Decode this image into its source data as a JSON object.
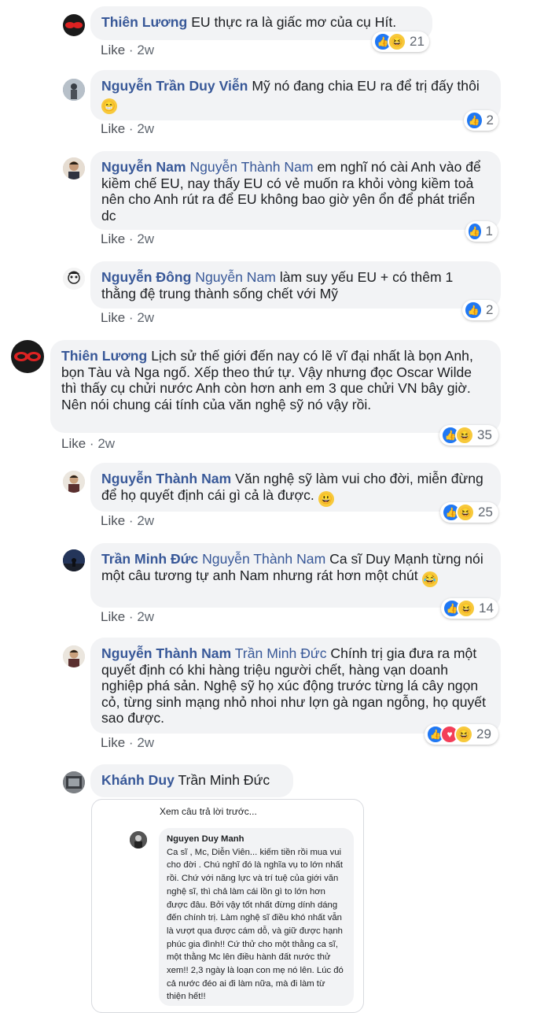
{
  "comments": [
    {
      "name": "Thiên Lương",
      "mention": "",
      "text": "EU thực ra là giấc mơ của cụ Hít.",
      "time": "2w",
      "reactions": "21"
    },
    {
      "name": "Nguyễn Trần Duy Viễn",
      "mention": "",
      "text": "Mỹ nó đang chia EU ra để trị đấy thôi",
      "time": "2w",
      "reactions": "2"
    },
    {
      "name": "Nguyễn Nam",
      "mention": "Nguyễn Thành Nam",
      "text": "em nghĩ nó cài Anh vào để kiềm chế EU, nay thấy EU có vẻ muốn ra khỏi vòng kiềm toả nên cho Anh rút ra để EU không bao giờ yên ổn để phát triển dc",
      "time": "2w",
      "reactions": "1"
    },
    {
      "name": "Nguyễn Đông",
      "mention": "Nguyễn Nam",
      "text": "làm suy yếu EU + có thêm 1 thằng đệ trung thành sống chết với Mỹ",
      "time": "2w",
      "reactions": "2"
    },
    {
      "name": "Thiên Lương",
      "mention": "",
      "text": "Lịch sử thế giới đến nay có lẽ vĩ đại nhất là bọn Anh, bọn Tàu và Nga ngố. Xếp theo thứ tự. Vậy nhưng đọc Oscar Wilde thì thấy cụ chửi nước Anh còn hơn anh em 3 que chửi VN bây giờ. Nên nói chung cái tính của văn nghệ sỹ nó vậy rồi.",
      "time": "2w",
      "reactions": "35"
    },
    {
      "name": "Nguyễn Thành Nam",
      "mention": "",
      "text": "Văn nghệ sỹ làm vui cho đời, miễn đừng để họ quyết định cái gì cả là được.",
      "time": "2w",
      "reactions": "25"
    },
    {
      "name": "Trần Minh Đức",
      "mention": "Nguyễn Thành Nam",
      "text": "Ca sĩ Duy Mạnh từng nói một câu tương tự anh Nam nhưng rát hơn một chút",
      "time": "2w",
      "reactions": "14"
    },
    {
      "name": "Nguyễn Thành Nam",
      "mention": "Trần Minh Đức",
      "text": "Chính trị gia đưa ra một quyết định có khi hàng triệu người chết, hàng vạn doanh nghiệp phá sản. Nghệ sỹ họ xúc động trước từng lá cây ngọn cỏ, từng sinh mạng nhỏ nhoi như lợn gà ngan ngỗng, họ quyết sao được.",
      "time": "2w",
      "reactions": "29"
    },
    {
      "name": "Khánh Duy",
      "mention": "",
      "text": "Trần Minh Đức",
      "time": "",
      "reactions": ""
    }
  ],
  "like_label": "Like",
  "sep": "·",
  "screenshot": {
    "prev_label": "Xem câu trả lời trước...",
    "name": "Nguyen Duy Manh",
    "text": "Ca sĩ , Mc, Diễn Viên... kiếm tiền rồi mua vui cho đời . Chú nghĩ đó là nghĩa vụ to lớn nhất rồi. Chứ với năng lực và trí tuệ của giới văn nghệ sĩ, thì chả làm cái lồn gì to lớn hơn được đâu. Bởi vậy tốt nhất đừng dính dáng đến chính trị. Làm nghệ sĩ điều khó nhất vẫn là vượt qua được cám dỗ, và giữ được hạnh phúc gia đình!! Cứ thử cho một thằng ca sĩ, một thằng Mc lên điều hành đất nước thử xem!! 2,3 ngày là loạn con mẹ nó lên. Lúc đó cả nước đéo ai đi làm nữa, mà đi làm từ thiện hết!!"
  }
}
